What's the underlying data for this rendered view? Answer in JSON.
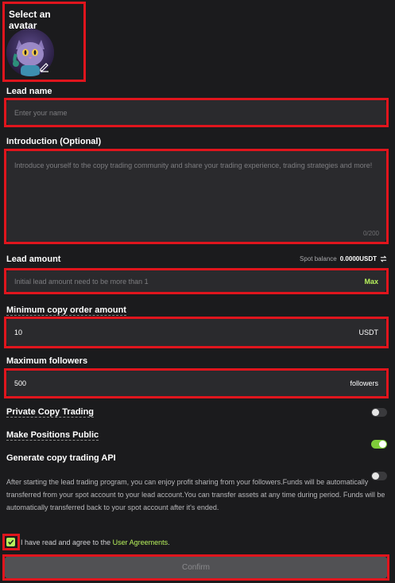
{
  "avatar": {
    "title": "Select an avatar"
  },
  "lead_name": {
    "label": "Lead name",
    "placeholder": "Enter your name"
  },
  "introduction": {
    "label": "Introduction (Optional)",
    "placeholder": "Introduce yourself to the copy trading community and share your trading experience, trading strategies and more!",
    "counter": "0/200"
  },
  "lead_amount": {
    "label": "Lead amount",
    "balance_label": "Spot balance",
    "balance_value": "0.0000USDT",
    "placeholder": "Initial lead amount need to be more than 1",
    "max_label": "Max"
  },
  "min_copy": {
    "label": "Minimum copy order amount",
    "value": "10",
    "unit": "USDT"
  },
  "max_followers": {
    "label": "Maximum followers",
    "value": "500",
    "unit": "followers"
  },
  "toggles": [
    {
      "label": "Private Copy Trading",
      "on": false
    },
    {
      "label": "Make Positions Public",
      "on": true
    },
    {
      "label": "Generate copy trading API",
      "on": false
    }
  ],
  "info": "After starting the lead trading program, you can enjoy profit sharing from your followers.Funds will be automatically transferred from your spot account to your lead account.You can transfer assets at any time during period. Funds will be automatically transferred back to your spot account after it's ended.",
  "agreement": {
    "text": "I have read and agree to the",
    "link": "User Agreements",
    "suffix": "."
  },
  "confirm_label": "Confirm",
  "colors": {
    "accent": "#b7f15c",
    "highlight": "#e0151d",
    "background": "#1b1b1d",
    "field": "#2a2a2d"
  }
}
